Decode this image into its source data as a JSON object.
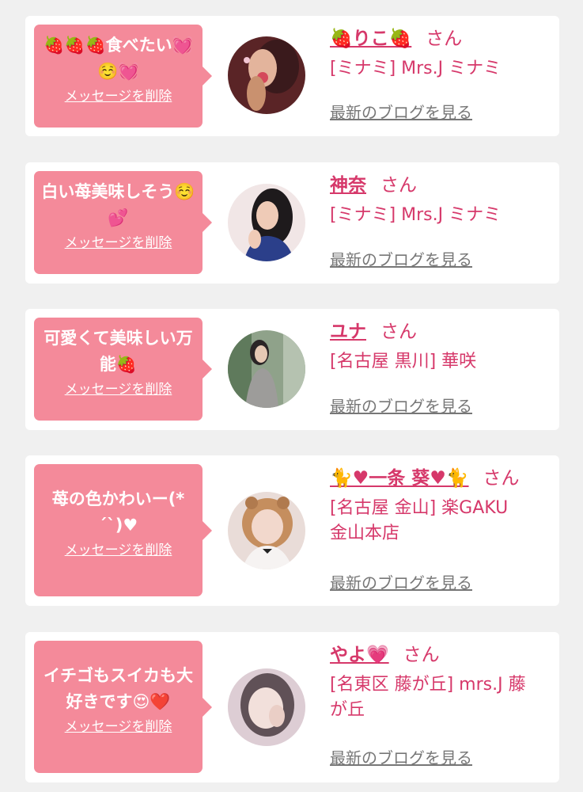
{
  "common": {
    "san": "さん",
    "delete_label": "メッセージを削除",
    "blog_label": "最新のブログを見る"
  },
  "items": [
    {
      "message": "🍓🍓🍓食べたい💓☺️💓",
      "name": "🍓りこ🍓",
      "shop": "[ミナミ] Mrs.J ミナミ"
    },
    {
      "message": "白い苺美味しそう☺️💕",
      "name": "神奈",
      "shop": "[ミナミ] Mrs.J ミナミ"
    },
    {
      "message": "可愛くて美味しい万能🍓",
      "name": "ユナ",
      "shop": "[名古屋 黒川] 華咲"
    },
    {
      "message": "苺の色かわいー(*´`)♥",
      "name": "🐈♥一条 葵♥🐈",
      "shop": "[名古屋 金山] 楽GAKU 金山本店"
    },
    {
      "message": "イチゴもスイカも大好きです😍❤️",
      "name": "やよ💗",
      "shop": "[名東区 藤が丘] mrs.J 藤が丘"
    }
  ]
}
